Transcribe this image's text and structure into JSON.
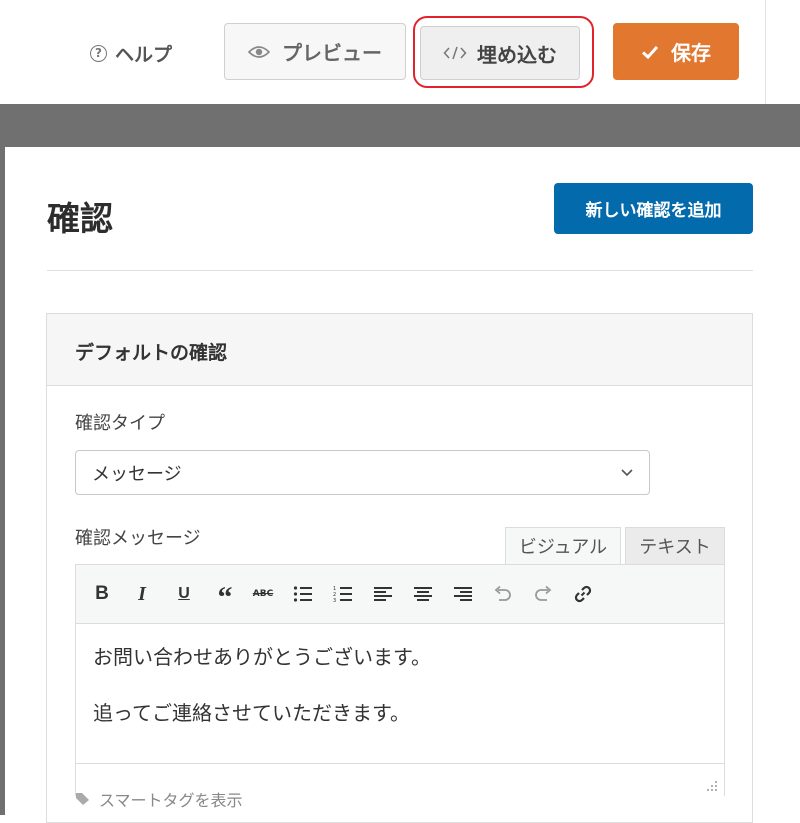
{
  "toolbar": {
    "help_label": "ヘルプ",
    "preview_label": "プレビュー",
    "embed_label": "埋め込む",
    "save_label": "保存"
  },
  "page": {
    "title": "確認",
    "add_button_label": "新しい確認を追加"
  },
  "card": {
    "title": "デフォルトの確認",
    "type_label": "確認タイプ",
    "type_value": "メッセージ",
    "message_label": "確認メッセージ",
    "tabs": [
      "ビジュアル",
      "テキスト"
    ],
    "editor_lines": [
      "お問い合わせありがとうございます。",
      "追ってご連絡させていただきます。"
    ],
    "smart_tag_label": "スマートタグを表示"
  },
  "icons": {
    "help": "question-circle-icon",
    "preview": "eye-icon",
    "embed": "code-icon",
    "save": "checkmark-icon"
  },
  "colors": {
    "save_button": "#e27730",
    "add_button": "#036aab",
    "highlight": "#e0232d",
    "backdrop": "#707070"
  }
}
